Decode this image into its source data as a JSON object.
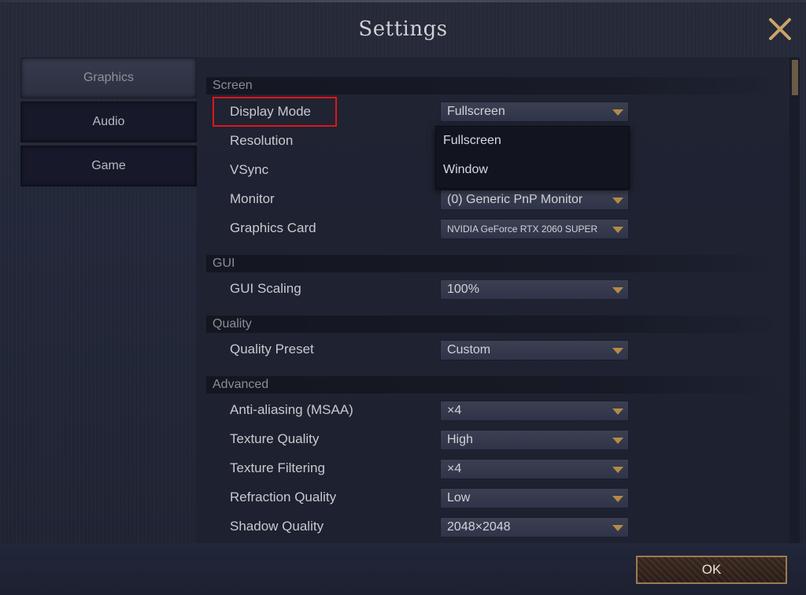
{
  "window": {
    "title": "Settings",
    "close_icon": "close-icon"
  },
  "sidebar": {
    "items": [
      {
        "label": "Graphics",
        "active": true
      },
      {
        "label": "Audio",
        "active": false
      },
      {
        "label": "Game",
        "active": false
      }
    ]
  },
  "sections": {
    "screen": "Screen",
    "gui": "GUI",
    "quality": "Quality",
    "advanced": "Advanced"
  },
  "settings": {
    "display_mode": {
      "label": "Display Mode",
      "value": "Fullscreen"
    },
    "resolution": {
      "label": "Resolution"
    },
    "vsync": {
      "label": "VSync"
    },
    "monitor": {
      "label": "Monitor",
      "value": "(0) Generic PnP Monitor"
    },
    "graphics_card": {
      "label": "Graphics Card",
      "value": "NVIDIA GeForce RTX 2060 SUPER"
    },
    "gui_scaling": {
      "label": "GUI Scaling",
      "value": "100%"
    },
    "quality_preset": {
      "label": "Quality Preset",
      "value": "Custom"
    },
    "anti_aliasing": {
      "label": "Anti-aliasing (MSAA)",
      "value": "×4"
    },
    "texture_quality": {
      "label": "Texture Quality",
      "value": "High"
    },
    "texture_filtering": {
      "label": "Texture Filtering",
      "value": "×4"
    },
    "refraction_quality": {
      "label": "Refraction Quality",
      "value": "Low"
    },
    "shadow_quality": {
      "label": "Shadow Quality",
      "value": "2048×2048"
    }
  },
  "display_mode_options": [
    "Fullscreen",
    "Window"
  ],
  "footer": {
    "ok_label": "OK"
  },
  "colors": {
    "accent_arrow": "#b58a46",
    "highlight_border": "#e0151b",
    "ok_border": "#9c7a54"
  }
}
